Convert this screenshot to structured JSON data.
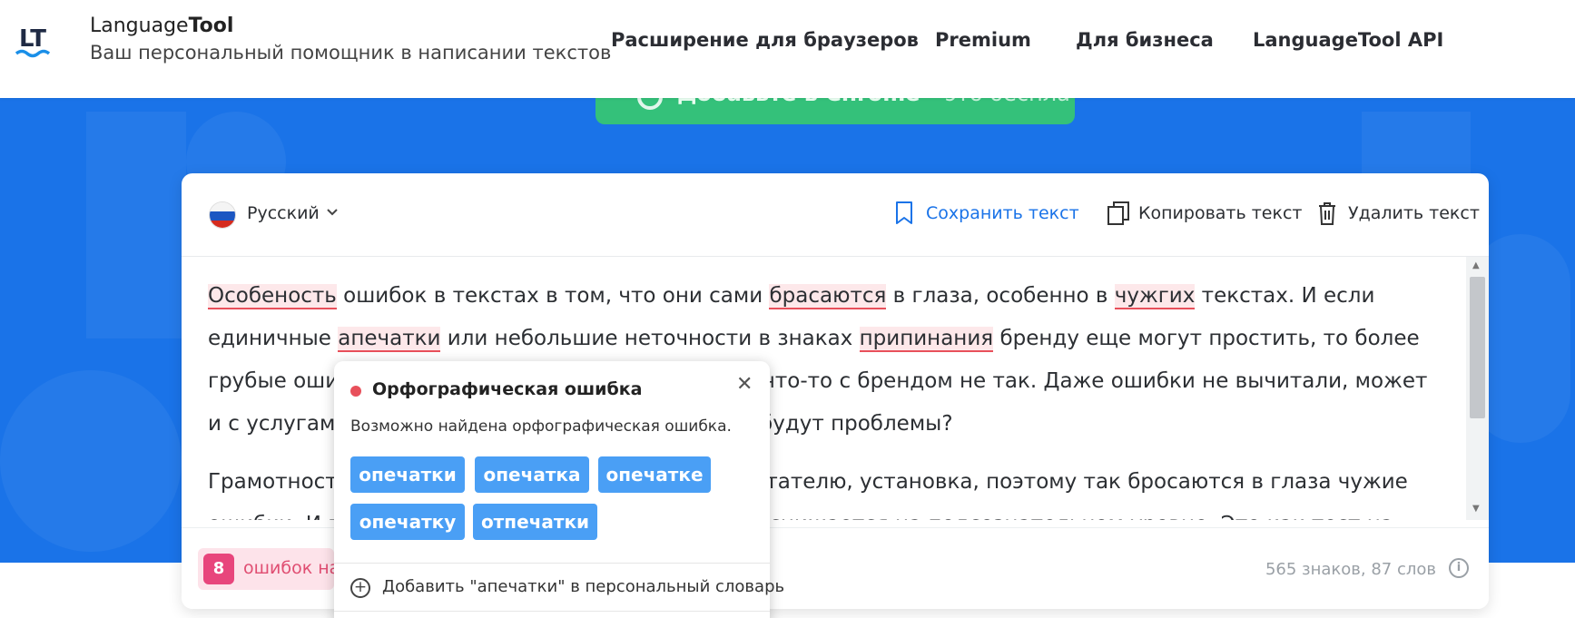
{
  "header": {
    "brand_bold": "Language",
    "brand_tool": "Tool",
    "tagline": "Ваш персональный помощник в написании текстов",
    "nav": [
      "Расширение для браузеров",
      "Premium",
      "Для бизнеса",
      "LanguageTool API"
    ]
  },
  "cta": {
    "label": "Добавьте в Chrome",
    "sub": " – это бесплатно!"
  },
  "toolbar": {
    "language": "Русский",
    "save_label": "Сохранить текст",
    "copy_label": "Копировать текст",
    "delete_label": "Удалить текст"
  },
  "editor": {
    "p1": [
      {
        "t": "Особеность",
        "e": "err"
      },
      {
        "t": " ошибок в текстах в том, что они сами "
      },
      {
        "t": "брасаются",
        "e": "err"
      },
      {
        "t": " в глаза, особенно в "
      },
      {
        "t": "чужгих",
        "e": "err"
      },
      {
        "t": " текстах. И если единичные "
      },
      {
        "t": "апечатки",
        "e": "err"
      },
      {
        "t": " или небольшие неточности в знаках "
      },
      {
        "t": "припинания",
        "e": "err"
      },
      {
        "t": " бренду еще могут простить, то более грубые оши"
      },
      {
        "t": "бки — это уже серьезный сигнал, что что-то с брендом не так. Даже ошибки не вычитали, может и с услугами"
      },
      {
        "t": ",ку",
        "e": "warn"
      },
      {
        "t": "да обратиться с вопросами, тоже будут пробл"
      },
      {
        "t": "емы?"
      }
    ],
    "p2": [
      {
        "t": "Грамотност"
      },
      {
        "t": "ь текста — это признак уважения к читателю, установка, поэтому так бросаются в глаза чужие ошибки. И поэтому доверие к н"
      },
      {
        "t": "ебрежному тексту снижается "
      },
      {
        "t": "на подсознательном уровне. Это как тест на уважение к"
      }
    ]
  },
  "status": {
    "errors_count": "8",
    "errors_text": "ошибок на",
    "chars": "565 знаков,",
    "words": "87 слов"
  },
  "popover": {
    "title": "Орфографическая ошибка",
    "description": "Возможно найдена орфографическая ошибка.",
    "suggestions": [
      "опечатки",
      "опечатка",
      "опечатке",
      "опечатку",
      "отпечатки"
    ],
    "add_to_dict": "Добавить \"апечатки\" в персональный словарь"
  },
  "colors": {
    "hero_blue": "#1a73e8",
    "cta_green": "#34c17a",
    "error_red": "#e8505b",
    "warning_orange": "#f2b13b",
    "suggestion_blue": "#4a9ff5",
    "link_blue": "#1a73e8",
    "badge_pink": "#e8457c"
  },
  "icons": {
    "logo": "languagetool-logo",
    "language_flag": "russia-flag-icon",
    "save": "bookmark-icon",
    "copy": "copy-icon",
    "delete": "trash-icon",
    "close": "close-icon",
    "info": "info-icon",
    "add": "plus-circle-icon"
  }
}
